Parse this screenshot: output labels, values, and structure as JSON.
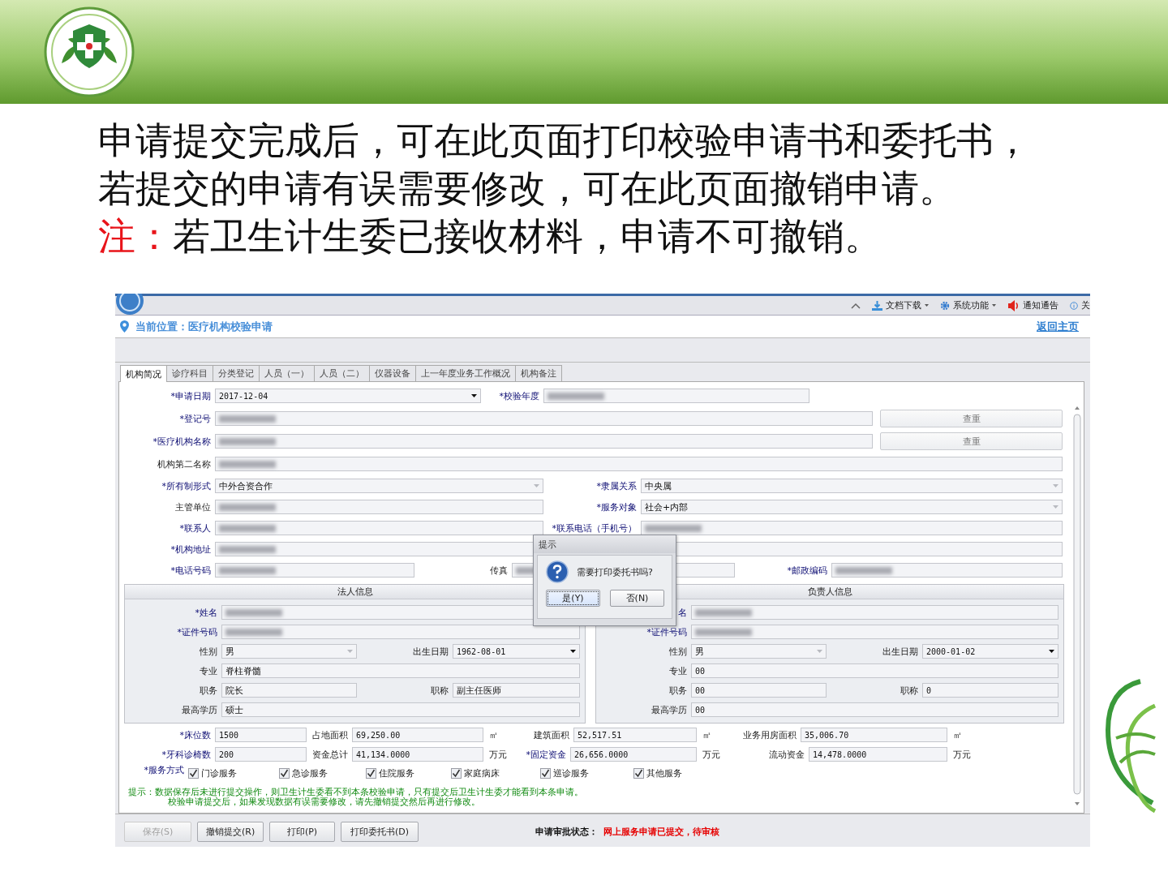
{
  "slide": {
    "intro_lines": [
      "申请提交完成后，可在此页面打印校验申请书和委托书，",
      "若提交的申请有误需要修改，可在此页面撤销申请。"
    ],
    "note": {
      "label": "注：",
      "text": "若卫生计生委已接收材料，申请不可撤销。"
    }
  },
  "app": {
    "toolbar": [
      {
        "kind": "download",
        "label": "文档下载",
        "dropdown": true
      },
      {
        "kind": "settings",
        "label": "系统功能",
        "dropdown": true
      },
      {
        "kind": "notice",
        "label": "通知通告",
        "dropdown": false
      },
      {
        "kind": "about",
        "label": "关",
        "dropdown": false
      }
    ],
    "breadcrumb": "当前位置：医疗机构校验申请",
    "home_link": "返回主页",
    "tabs": [
      {
        "label": "机构简况",
        "selected": true
      },
      {
        "label": "诊疗科目",
        "selected": false
      },
      {
        "label": "分类登记",
        "selected": false
      },
      {
        "label": "人员（一）",
        "selected": false
      },
      {
        "label": "人员（二）",
        "selected": false
      },
      {
        "label": "仪器设备",
        "selected": false
      },
      {
        "label": "上一年度业务工作概况",
        "selected": false
      },
      {
        "label": "机构备注",
        "selected": false
      }
    ],
    "form_rows": [
      [
        {
          "label": "*申请日期",
          "required": true,
          "kind": "date",
          "value": "2017-12-04"
        },
        {
          "label": "*校验年度",
          "required": true,
          "kind": "text",
          "blurred": true
        }
      ],
      [
        {
          "label": "*登记号",
          "required": true,
          "kind": "text",
          "blurred": true
        },
        {
          "kind": "button",
          "label": "查重"
        }
      ],
      [
        {
          "label": "*医疗机构名称",
          "required": true,
          "kind": "text",
          "blurred": true
        },
        {
          "kind": "button",
          "label": "查重"
        }
      ],
      [
        {
          "label": "机构第二名称",
          "required": false,
          "kind": "text",
          "blurred": true
        }
      ],
      [
        {
          "label": "*所有制形式",
          "required": true,
          "kind": "select",
          "value": "中外合资合作"
        },
        {
          "label": "*隶属关系",
          "required": true,
          "kind": "select",
          "value": "中央属"
        }
      ],
      [
        {
          "label": "主管单位",
          "required": false,
          "kind": "text",
          "blurred": true
        },
        {
          "label": "*服务对象",
          "required": true,
          "kind": "select",
          "value": "社会+内部"
        }
      ],
      [
        {
          "label": "*联系人",
          "required": true,
          "kind": "text",
          "blurred": true
        },
        {
          "label": "*联系电话（手机号）",
          "required": true,
          "kind": "text",
          "blurred": true
        }
      ],
      [
        {
          "label": "*机构地址",
          "required": true,
          "kind": "text",
          "blurred": true
        }
      ],
      [
        {
          "label": "*电话号码",
          "required": true,
          "kind": "text",
          "blurred": true
        },
        {
          "label": "传真",
          "required": false,
          "kind": "text",
          "blurred": true
        },
        {
          "label": "*邮政编码",
          "required": true,
          "kind": "text",
          "blurred": true
        }
      ]
    ],
    "panels": [
      {
        "title": "法人信息",
        "rows": [
          [
            {
              "label": "*姓名",
              "required": true,
              "kind": "text",
              "blurred": true
            }
          ],
          [
            {
              "label": "*证件号码",
              "required": true,
              "kind": "text",
              "blurred": true
            }
          ],
          [
            {
              "label": "性别",
              "required": false,
              "kind": "select",
              "value": "男"
            },
            {
              "label": "出生日期",
              "required": false,
              "kind": "date",
              "value": "1962-08-01"
            }
          ],
          [
            {
              "label": "专业",
              "required": false,
              "kind": "text",
              "value": "脊柱脊髓"
            }
          ],
          [
            {
              "label": "职务",
              "required": false,
              "kind": "text",
              "value": "院长"
            },
            {
              "label": "职称",
              "required": false,
              "kind": "text",
              "value": "副主任医师"
            }
          ],
          [
            {
              "label": "最高学历",
              "required": false,
              "kind": "text",
              "value": "硕士"
            }
          ]
        ]
      },
      {
        "title": "负责人信息",
        "rows": [
          [
            {
              "label": "名",
              "required": true,
              "kind": "text",
              "blurred": true
            }
          ],
          [
            {
              "label": "*证件号码",
              "required": true,
              "kind": "text",
              "blurred": true
            }
          ],
          [
            {
              "label": "性别",
              "required": false,
              "kind": "select",
              "value": "男"
            },
            {
              "label": "出生日期",
              "required": false,
              "kind": "date",
              "value": "2000-01-02"
            }
          ],
          [
            {
              "label": "专业",
              "required": false,
              "kind": "text",
              "value": "00"
            }
          ],
          [
            {
              "label": "职务",
              "required": false,
              "kind": "text",
              "value": "00"
            },
            {
              "label": "职称",
              "required": false,
              "kind": "text",
              "value": "0"
            }
          ],
          [
            {
              "label": "最高学历",
              "required": false,
              "kind": "text",
              "value": "00"
            }
          ]
        ]
      }
    ],
    "stats_rows": [
      [
        {
          "label": "*床位数",
          "required": true,
          "kind": "text",
          "value": "1500"
        },
        {
          "label": "占地面积",
          "required": false,
          "kind": "text",
          "value": "69,250.00",
          "unit": "㎡"
        },
        {
          "label": "建筑面积",
          "required": false,
          "kind": "text",
          "value": "52,517.51",
          "unit": "㎡"
        },
        {
          "label": "业务用房面积",
          "required": false,
          "kind": "text",
          "value": "35,006.70",
          "unit": "㎡"
        }
      ],
      [
        {
          "label": "*牙科诊椅数",
          "required": true,
          "kind": "text",
          "value": "200"
        },
        {
          "label": "资金总计",
          "required": false,
          "kind": "text",
          "value": "41,134.0000",
          "unit": "万元"
        },
        {
          "label": "*固定资金",
          "required": true,
          "kind": "text",
          "value": "26,656.0000",
          "unit": "万元"
        },
        {
          "label": "流动资金",
          "required": false,
          "kind": "text",
          "value": "14,478.0000",
          "unit": "万元"
        }
      ]
    ],
    "services": {
      "label": "*服务方式",
      "required": true,
      "options": [
        {
          "label": "门诊服务",
          "checked": true
        },
        {
          "label": "急诊服务",
          "checked": true
        },
        {
          "label": "住院服务",
          "checked": true
        },
        {
          "label": "家庭病床",
          "checked": true
        },
        {
          "label": "巡诊服务",
          "checked": true
        },
        {
          "label": "其他服务",
          "checked": true
        }
      ]
    },
    "tips": [
      "提示：数据保存后未进行提交操作，则卫生计生委看不到本条校验申请，只有提交后卫生计生委才能看到本条申请。",
      "校验申请提交后，如果发现数据有误需要修改，请先撤销提交然后再进行修改。"
    ],
    "buttons": [
      {
        "label": "保存(S)",
        "disabled": true
      },
      {
        "label": "撤销提交(R)",
        "disabled": false
      },
      {
        "label": "打印(P)",
        "disabled": false
      },
      {
        "label": "打印委托书(D)",
        "disabled": false
      }
    ],
    "status": {
      "label": "申请审批状态：",
      "value": "网上服务申请已提交，待审核"
    },
    "dialog": {
      "title": "提示",
      "message": "需要打印委托书吗?",
      "buttons": [
        {
          "label": "是(Y)",
          "focused": true
        },
        {
          "label": "否(N)",
          "focused": false
        }
      ]
    }
  }
}
